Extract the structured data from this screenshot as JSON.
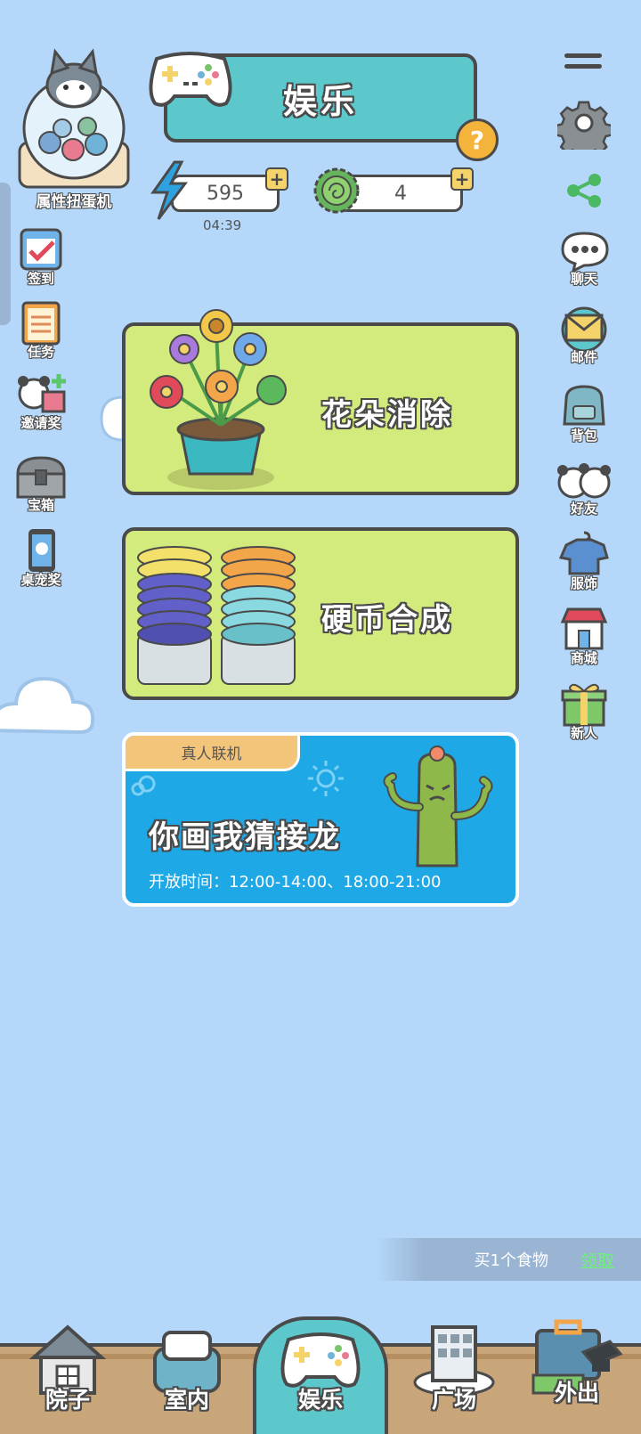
{
  "header": {
    "title": "娱乐",
    "capsule_label": "属性扭蛋机",
    "help_symbol": "?"
  },
  "resources": {
    "energy_value": "595",
    "energy_timer": "04:39",
    "clover_value": "4",
    "plus_symbol": "+"
  },
  "left_menu": [
    {
      "label": "签到",
      "icon": "calendar-check-icon"
    },
    {
      "label": "任务",
      "icon": "task-list-icon"
    },
    {
      "label": "邀请奖",
      "icon": "panda-gift-icon"
    },
    {
      "label": "宝箱",
      "icon": "treasure-chest-icon"
    },
    {
      "label": "桌宠奖",
      "icon": "phone-pet-icon"
    }
  ],
  "right_menu": [
    {
      "label": "聊天",
      "icon": "chat-bubble-icon"
    },
    {
      "label": "邮件",
      "icon": "mail-icon"
    },
    {
      "label": "背包",
      "icon": "backpack-icon"
    },
    {
      "label": "好友",
      "icon": "panda-friends-icon"
    },
    {
      "label": "服饰",
      "icon": "clothes-icon"
    },
    {
      "label": "商城",
      "icon": "shop-icon"
    },
    {
      "label": "新人",
      "icon": "gift-box-icon"
    }
  ],
  "games": {
    "flower": {
      "title": "花朵消除"
    },
    "coin": {
      "title": "硬币合成"
    },
    "draw": {
      "tag": "真人联机",
      "title": "你画我猜接龙",
      "hours": "开放时间：12:00-14:00、18:00-21:00"
    }
  },
  "promo": {
    "text": "买1个食物",
    "claim": "领取"
  },
  "bottom_nav": [
    {
      "label": "院子",
      "icon": "house-icon",
      "active": false
    },
    {
      "label": "室内",
      "icon": "bed-icon",
      "active": false
    },
    {
      "label": "娱乐",
      "icon": "gamepad-icon",
      "active": true
    },
    {
      "label": "广场",
      "icon": "building-icon",
      "active": false
    },
    {
      "label": "外出",
      "icon": "suitcase-icon",
      "active": false
    }
  ],
  "colors": {
    "background": "#b5d8fa",
    "banner": "#5cc8cc",
    "card_green": "#d3ea7c",
    "card_blue": "#1fa8e6",
    "outline": "#4a4a4a"
  }
}
